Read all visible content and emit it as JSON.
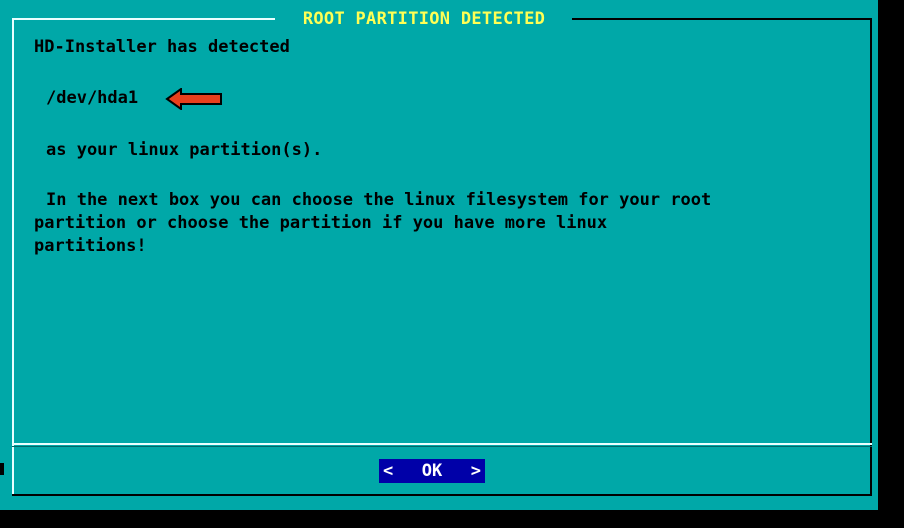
{
  "dialog": {
    "title": "ROOT PARTITION DETECTED",
    "lines": {
      "detected": "HD-Installer has detected",
      "device": "/dev/hda1",
      "as_partition": "as your linux partition(s).",
      "next_box_1": "In the next box you can choose the linux filesystem for your root",
      "next_box_2": "partition or choose the partition if you have more linux",
      "next_box_3": "partitions!"
    },
    "ok_button": {
      "left_bracket": "<",
      "label": "OK",
      "right_bracket": ">"
    },
    "colors": {
      "background": "#00a8a8",
      "title": "#ffff54",
      "text": "#000000",
      "button_background": "#0000a8",
      "button_text": "#ffffff",
      "arrow": "#e8401c"
    },
    "annotation_icon": "red-arrow-pointing-left-icon"
  }
}
